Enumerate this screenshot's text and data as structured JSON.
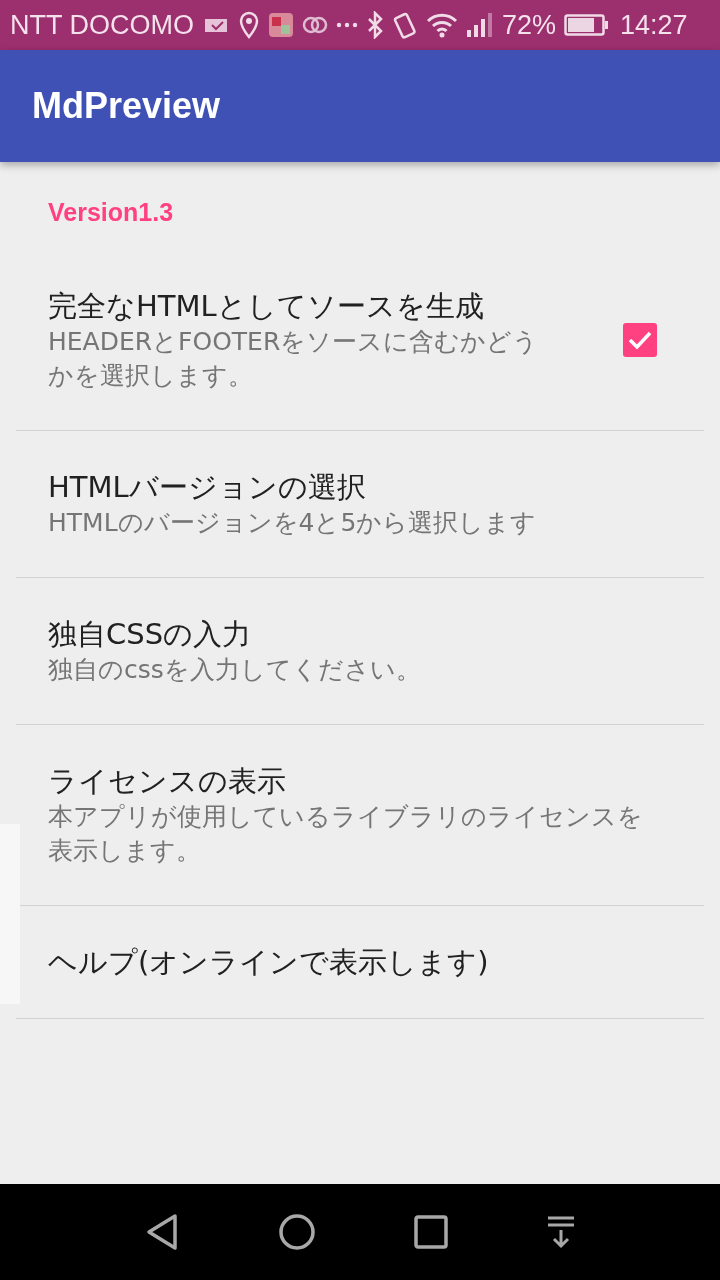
{
  "status_bar": {
    "carrier": "NTT DOCOMO",
    "battery": "72%",
    "time": "14:27"
  },
  "app_bar": {
    "title": "MdPreview"
  },
  "category": "Version1.3",
  "preferences": [
    {
      "kind": "checkbox",
      "title": "完全なHTMLとしてソースを生成",
      "summary": "HEADERとFOOTERをソースに含むかどうかを選択します。",
      "checked": true
    },
    {
      "kind": "plain",
      "title": "HTMLバージョンの選択",
      "summary": "HTMLのバージョンを4と5から選択します"
    },
    {
      "kind": "plain",
      "title": "独自CSSの入力",
      "summary": "独自のcssを入力してください。"
    },
    {
      "kind": "plain",
      "title": "ライセンスの表示",
      "summary": "本アプリが使用しているライブラリのライセンスを表示します。"
    },
    {
      "kind": "plain",
      "title": "ヘルプ(オンラインで表示します)"
    }
  ]
}
